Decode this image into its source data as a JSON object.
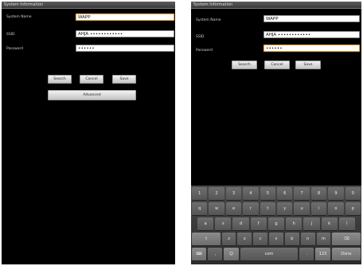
{
  "left": {
    "title": "System Information",
    "labels": {
      "system_name": "System Name",
      "ssid": "SSID",
      "password": "Password"
    },
    "values": {
      "system_name": "WAPP",
      "ssid": "AHJA ∙∙∙∙∙∙∙∙∙∙∙∙",
      "password": "∙∙∙∙∙∙"
    },
    "buttons": {
      "search": "Search",
      "cancel": "Cancel",
      "save": "Save",
      "advanced": "Advanced"
    }
  },
  "right": {
    "title": "System Information",
    "labels": {
      "system_name": "System Name",
      "ssid": "SSID",
      "password": "Password"
    },
    "values": {
      "system_name": "WAPP",
      "ssid": "AHJA ∙∙∙∙∙∙∙∙∙∙∙∙",
      "password": "∙∙∙∙∙∙"
    },
    "buttons": {
      "search": "Search",
      "cancel": "Cancel",
      "save": "Save"
    }
  },
  "keyboard": {
    "row1": [
      "1",
      "2",
      "3",
      "4",
      "5",
      "6",
      "7",
      "8",
      "9",
      "0"
    ],
    "row2": [
      "q",
      "w",
      "e",
      "r",
      "t",
      "y",
      "u",
      "i",
      "o",
      "p"
    ],
    "row3": [
      "a",
      "s",
      "d",
      "f",
      "g",
      "h",
      "j",
      "k",
      "l"
    ],
    "row4": [
      "⇧",
      "z",
      "x",
      "c",
      "v",
      "b",
      "n",
      "m",
      "⌫"
    ],
    "row5": [
      "⌨",
      ",",
      "☺",
      "com",
      ".",
      "123",
      "Done"
    ]
  },
  "colors": {
    "background": "#000000",
    "focus": "#e39a3b",
    "keyboard": "#3a3a3a"
  }
}
